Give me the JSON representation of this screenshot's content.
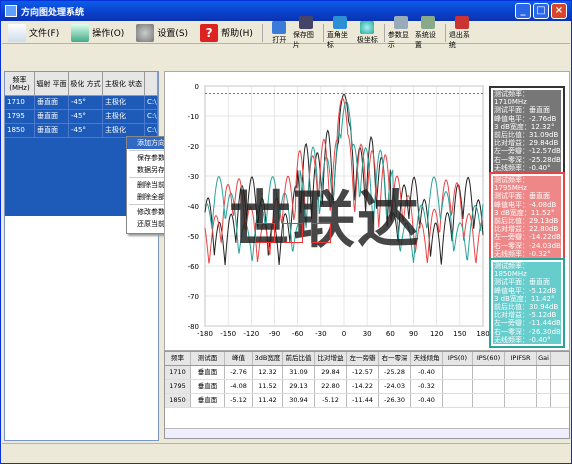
{
  "window": {
    "title": "方向图处理系统"
  },
  "menu": [
    {
      "label": "文件(F)",
      "icon": "document-icon"
    },
    {
      "label": "操作(O)",
      "icon": "tools-icon"
    },
    {
      "label": "设置(S)",
      "icon": "gear-icon"
    },
    {
      "label": "帮助(H)",
      "icon": "help-icon"
    }
  ],
  "toolbar": [
    "打开",
    "保存图片",
    "直角坐标",
    "极坐标",
    "参数显示",
    "系统设置",
    "退出系统"
  ],
  "left_table": {
    "headers": [
      "频率\n(MHz)",
      "辐射\n平面",
      "极化\n方式",
      "主极化\n状态"
    ],
    "rows": [
      [
        "1710",
        "垂直面",
        "-45°",
        "主极化",
        "C:\\"
      ],
      [
        "1795",
        "垂直面",
        "-45°",
        "主极化",
        "C:\\"
      ],
      [
        "1850",
        "垂直面",
        "-45°",
        "主极化",
        "C:\\"
      ]
    ]
  },
  "context_menu": [
    "添加方向图",
    "保存参数",
    "数据另存为",
    "删除当前数据",
    "删除全部数据",
    "修改参数",
    "还原当前数据"
  ],
  "chart_data": {
    "type": "line",
    "x_ticks": [
      -180,
      -150,
      -120,
      -90,
      -60,
      -30,
      0,
      30,
      60,
      90,
      120,
      150,
      180
    ],
    "y_ticks": [
      0,
      -10,
      -20,
      -30,
      -40,
      -50,
      -60,
      -70,
      -80
    ],
    "xlim": [
      -180,
      180
    ],
    "ylim": [
      -80,
      0
    ],
    "grid": true,
    "series": [
      {
        "color": "#222222"
      },
      {
        "color": "#e84444"
      },
      {
        "color": "#2aa398"
      }
    ]
  },
  "info_boxes": [
    {
      "color": "#333333",
      "lines": [
        "测试频率：1710MHz",
        "测试平面：垂直面",
        "峰值电平：-2.76dB",
        "3 dB宽度：12.32°",
        "前后比值：31.09dB",
        "比对增益：29.84dB",
        "左一旁瓣：-12.57dB",
        "右一零深：-25.28dB",
        "无线频率：-0.40°"
      ]
    },
    {
      "color": "#e84444",
      "lines": [
        "测试频率：1795MHz",
        "测试平面：垂直面",
        "峰值电平：-4.08dB",
        "3 dB宽度：11.52°",
        "前后比值：29.13dB",
        "比对增益：22.80dB",
        "左一旁瓣：-14.22dB",
        "右一零深：-24.03dB",
        "无线频率：-0.32°"
      ]
    },
    {
      "color": "#2aa398",
      "lines": [
        "测试频率：1850MHz",
        "测试平面：垂直面",
        "峰值电平：-5.12dB",
        "3 dB宽度：11.42°",
        "前后比值：30.94dB",
        "比对增益：-5.12dB",
        "左一旁瓣：-11.44dB",
        "右一零深：-26.30dB",
        "无线频率：-0.40°"
      ]
    }
  ],
  "bottom_table": {
    "headers": [
      "频率",
      "测试面",
      "峰值",
      "3dB宽度",
      "前后比值",
      "比对增益",
      "左一旁瓣",
      "右一零深",
      "天线倾角",
      "IPS(0)",
      "IPS(60)",
      "IPIFSR",
      "Gai"
    ],
    "rows": [
      [
        "1710",
        "垂直面",
        "-2.76",
        "12.32",
        "31.09",
        "29.84",
        "-12.57",
        "-25.28",
        "-0.40",
        "",
        "",
        "",
        ""
      ],
      [
        "1795",
        "垂直面",
        "-4.08",
        "11.52",
        "29.13",
        "22.80",
        "-14.22",
        "-24.03",
        "-0.32",
        "",
        "",
        "",
        ""
      ],
      [
        "1850",
        "垂直面",
        "-5.12",
        "11.42",
        "30.94",
        "-5.12",
        "-11.44",
        "-26.30",
        "-0.40",
        "",
        "",
        "",
        ""
      ]
    ]
  },
  "watermark": "世联达"
}
